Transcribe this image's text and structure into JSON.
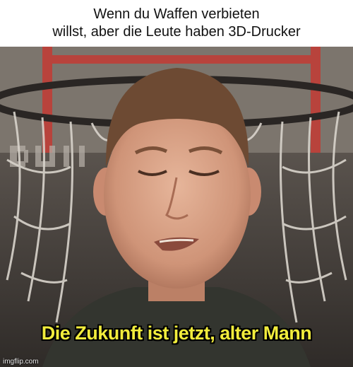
{
  "meme": {
    "top_text": {
      "line1": "Wenn du Waffen verbieten",
      "line2": "willst, aber die Leute haben 3D-Drucker"
    },
    "bottom_text": "Die Zukunft ist jetzt, alter Mann",
    "watermark": "imgflip.com"
  },
  "colors": {
    "caption_background": "#ffffff",
    "caption_text": "#111111",
    "bottom_text_fill": "#f1ec3c",
    "bottom_text_outline": "#000000"
  }
}
